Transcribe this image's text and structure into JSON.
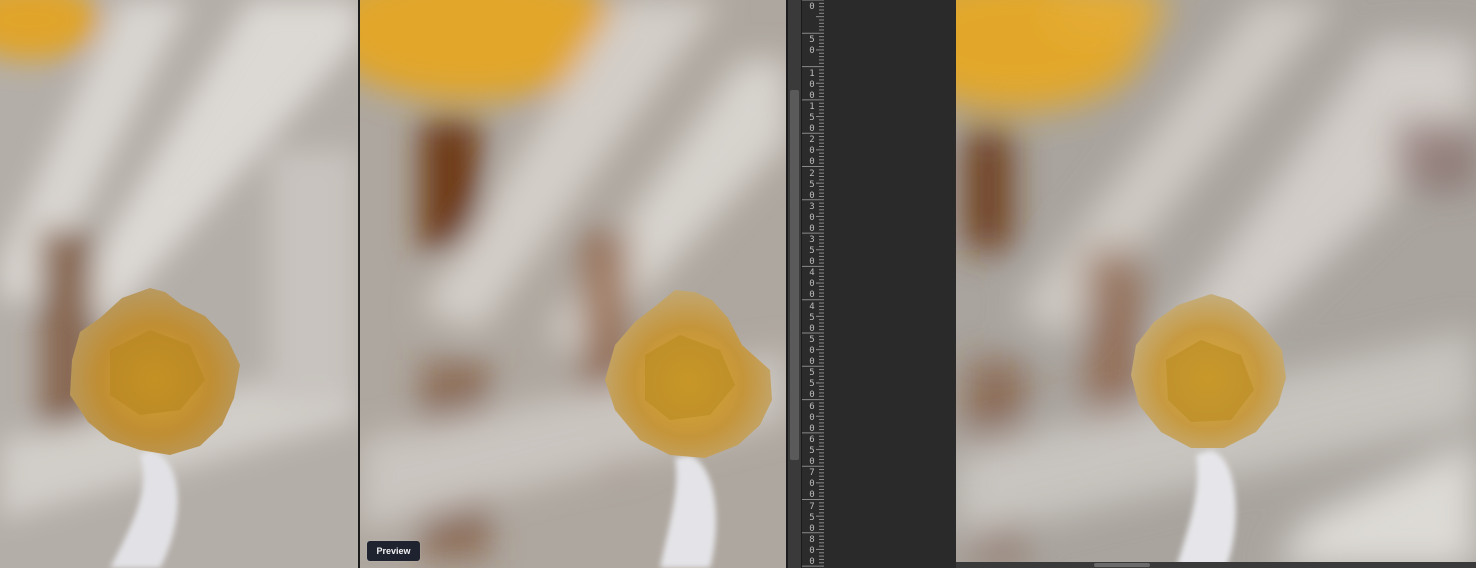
{
  "panels": {
    "left": {
      "name": "reference-photo"
    },
    "middle": {
      "name": "preview-photo"
    },
    "right": {
      "name": "document-photo"
    }
  },
  "preview_badge": {
    "label": "Preview"
  },
  "ruler": {
    "labels": [
      "0",
      "50",
      "100",
      "150",
      "200",
      "250",
      "300",
      "350",
      "400",
      "450",
      "500",
      "550",
      "600",
      "650",
      "700",
      "750",
      "800"
    ]
  },
  "colors": {
    "background": "#262626",
    "ruler_bg": "#2b2b2b",
    "badge_bg": "#1f2330",
    "pollen_gold": "#c9982e",
    "petal_gray": "#b9b4ae",
    "flower_yellow": "#e1a62b"
  }
}
